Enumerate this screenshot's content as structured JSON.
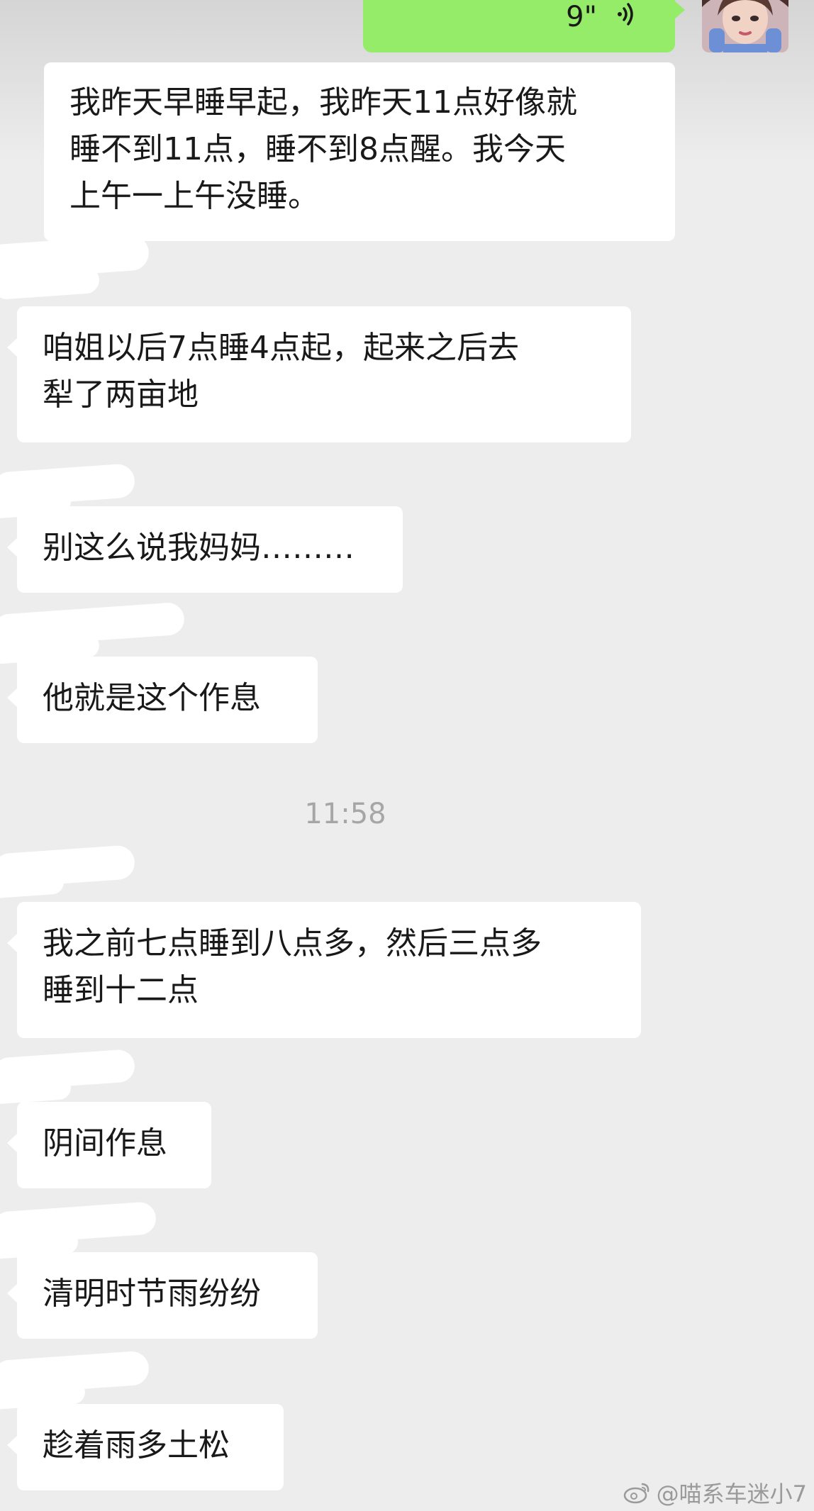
{
  "outgoing_voice": {
    "duration": "9\"",
    "icon": "voice-wave-icon"
  },
  "messages": [
    {
      "lines": [
        "我昨天早睡早起，我昨天11点好像就",
        "睡不到11点，睡不到8点醒。我今天",
        "上午一上午没睡。"
      ]
    },
    {
      "lines": [
        "咱姐以后7点睡4点起，起来之后去",
        "犁了两亩地"
      ]
    },
    {
      "lines": [
        "别这么说我妈妈………"
      ]
    },
    {
      "lines": [
        "他就是这个作息"
      ]
    },
    {
      "lines": [
        "我之前七点睡到八点多，然后三点多",
        "睡到十二点"
      ]
    },
    {
      "lines": [
        "阴间作息"
      ]
    },
    {
      "lines": [
        "清明时节雨纷纷"
      ]
    },
    {
      "lines": [
        "趁着雨多土松"
      ]
    }
  ],
  "timestamp": "11:58",
  "watermark": "@喵系车迷小7",
  "colors": {
    "background": "#ededed",
    "outgoing_bubble": "#95ec69",
    "incoming_bubble": "#ffffff",
    "timestamp_text": "#a6a6a6"
  }
}
